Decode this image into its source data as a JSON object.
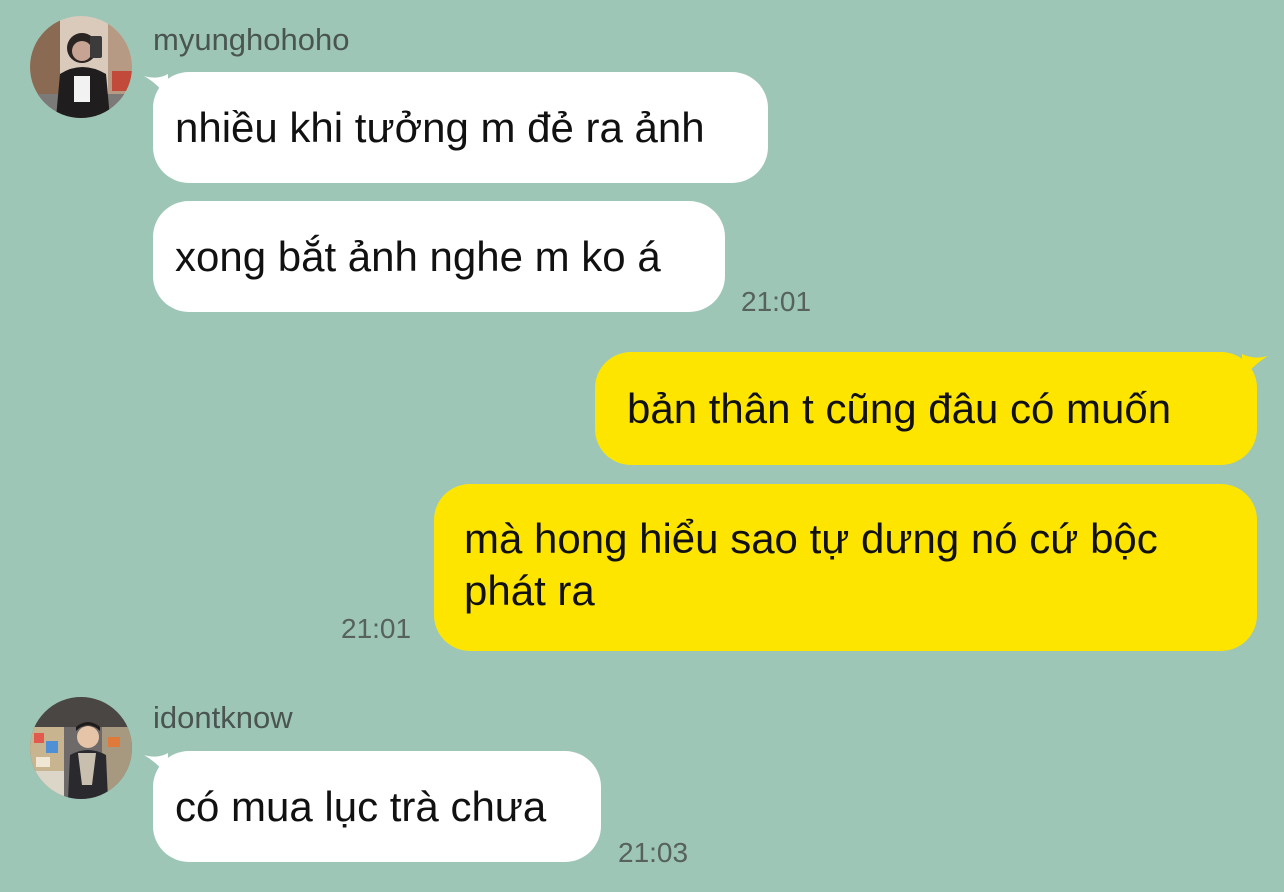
{
  "conversation": {
    "theme": {
      "background": "#9dc6b6",
      "incoming_bubble": "#ffffff",
      "outgoing_bubble": "#fee500"
    },
    "group1": {
      "sender": "myunghohoho",
      "avatar_icon": "profile-photo",
      "messages": [
        "nhiều khi tưởng m đẻ ra ảnh",
        "xong bắt ảnh nghe m ko á"
      ],
      "time": "21:01"
    },
    "group2": {
      "messages": [
        "bản thân t cũng đâu có muốn",
        "mà hong hiểu sao tự dưng nó cứ bộc phát ra"
      ],
      "time": "21:01"
    },
    "group3": {
      "sender": "idontknow",
      "avatar_icon": "profile-photo",
      "messages": [
        "có mua lục trà chưa"
      ],
      "time": "21:03"
    }
  }
}
